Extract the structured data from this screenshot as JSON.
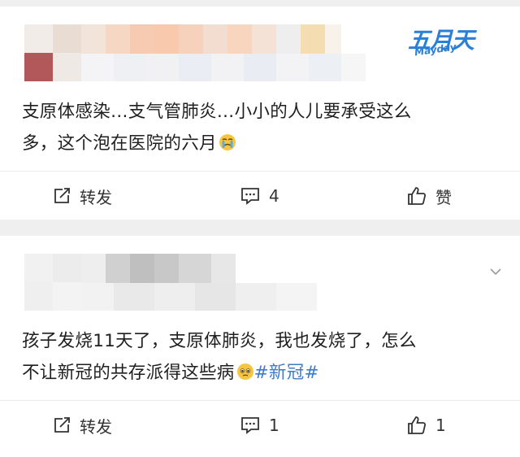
{
  "posts": [
    {
      "text_line1": "支原体感染…支气管肺炎…小小的人儿要承受这么",
      "text_line2": "多，这个泡在医院的六月",
      "emoji": "crying-face-emoji",
      "actions": {
        "repost_label": "转发",
        "comment_count": "4",
        "like_label": "赞"
      }
    },
    {
      "text_line1": "孩子发烧11天了，支原体肺炎，我也发烧了，怎么",
      "text_line2": "不让新冠的共存派得这些病",
      "emoji": "pleading-face-emoji",
      "hashtag": "#新冠#",
      "actions": {
        "repost_label": "转发",
        "comment_count": "1",
        "like_count": "1"
      }
    }
  ],
  "brand_logo": {
    "main": "五月天",
    "sub": "Mayday"
  },
  "colors": {
    "hashtag": "#3d7cc9",
    "brand": "#2a7fd6",
    "background": "#efefef"
  }
}
